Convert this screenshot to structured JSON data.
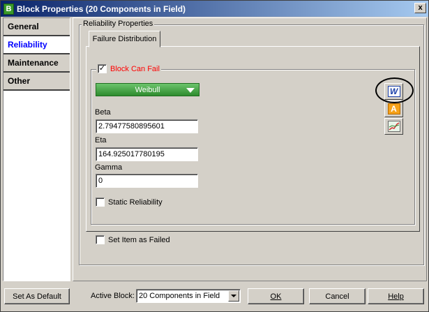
{
  "window": {
    "title": "Block Properties (20 Components in Field)",
    "app_icon_letter": "B",
    "close_label": "x"
  },
  "nav": {
    "items": [
      {
        "label": "General",
        "active": false
      },
      {
        "label": "Reliability",
        "active": true
      },
      {
        "label": "Maintenance",
        "active": false
      },
      {
        "label": "Other",
        "active": false
      }
    ]
  },
  "reliability": {
    "group_label": "Reliability Properties",
    "tab_label": "Failure Distribution",
    "block_can_fail": {
      "label": "Block Can Fail",
      "checked": true
    },
    "distribution": "Weibull",
    "beta": {
      "label": "Beta",
      "value": "2.79477580895601"
    },
    "eta": {
      "label": "Eta",
      "value": "164.925017780195"
    },
    "gamma": {
      "label": "Gamma",
      "value": "0"
    },
    "static_reliability": {
      "label": "Static Reliability",
      "checked": false
    },
    "side_icons": [
      "weibull-icon",
      "analysis-icon",
      "plot-icon"
    ],
    "side_icon_letters": {
      "w": "W",
      "a": "A"
    }
  },
  "set_failed": {
    "label": "Set Item as Failed",
    "checked": false
  },
  "footer": {
    "set_default_label": "Set As Default",
    "active_block_label": "Active Block:",
    "active_block_value": "20 Components in Field",
    "ok_label": "OK",
    "cancel_label": "Cancel",
    "help_label": "Help"
  },
  "colors": {
    "accent_green": "#2e8b2e",
    "active_nav": "#0000ff",
    "checkbox_label_red": "#ff0000"
  }
}
